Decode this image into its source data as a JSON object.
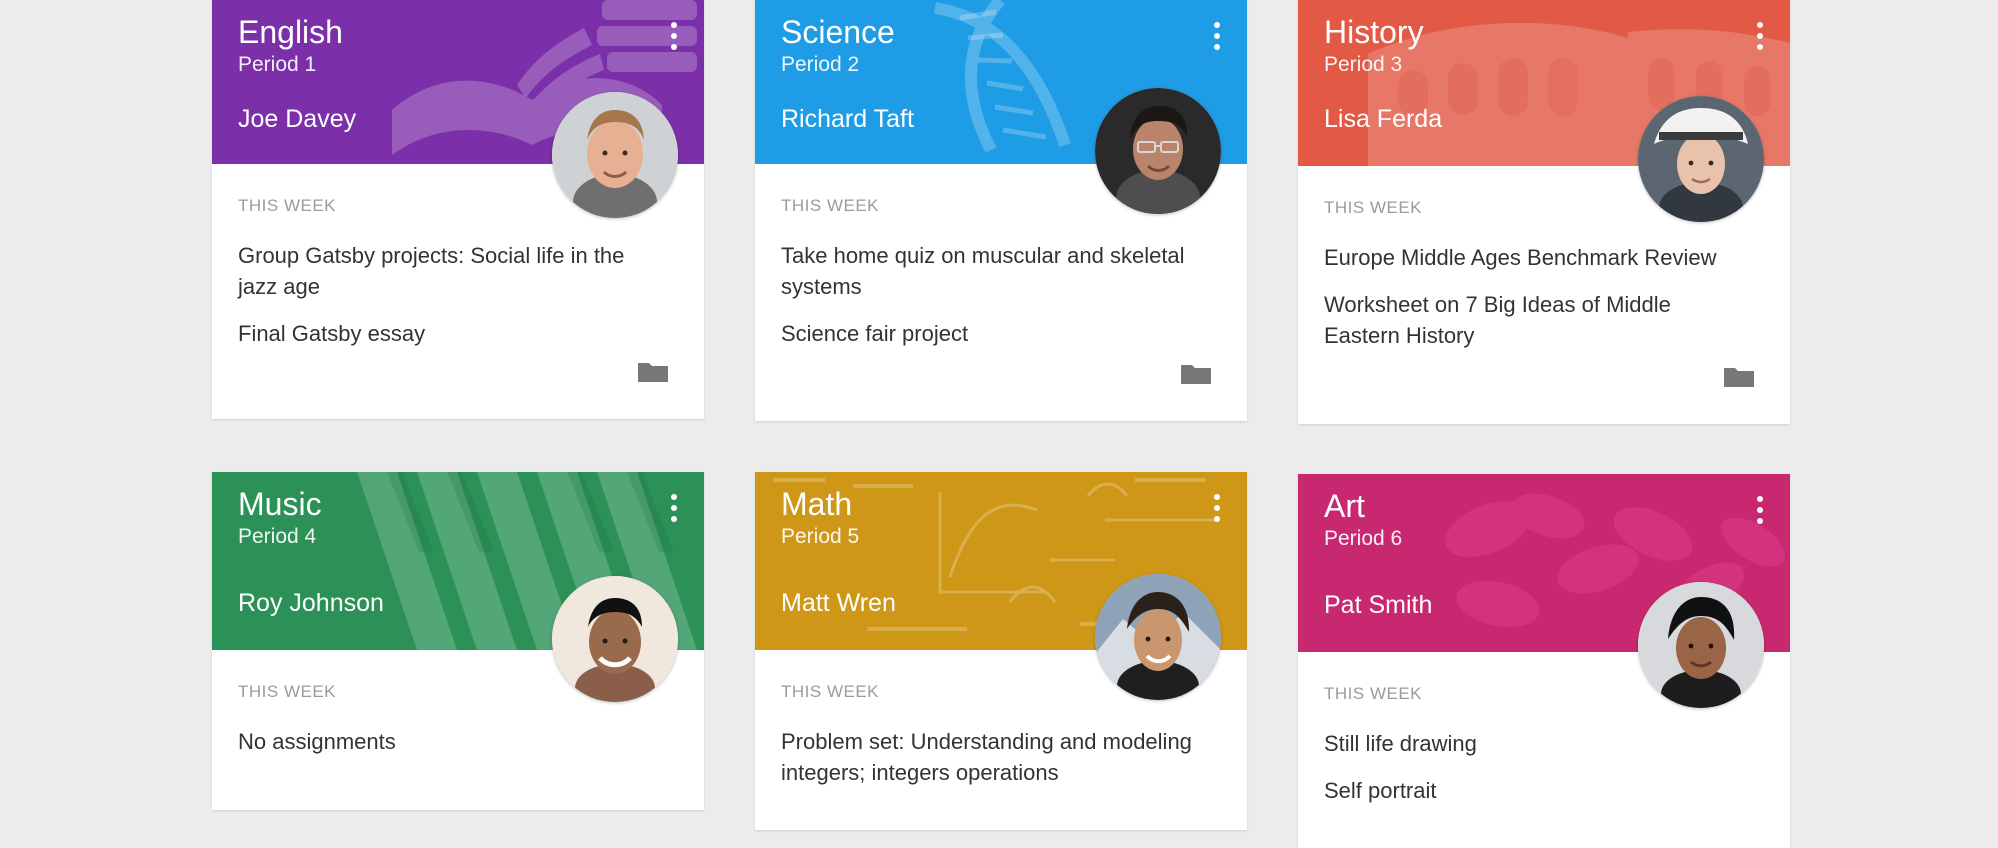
{
  "classes": [
    {
      "subject": "English",
      "period": "Period 1",
      "teacher": "Joe Davey",
      "color": "#7b2fa8",
      "section_label": "THIS WEEK",
      "assignments": [
        "Group Gatsby projects: Social life in the jazz age",
        "Final Gatsby essay"
      ],
      "has_folder": true,
      "header_art": "book-icon",
      "avatar_hair": "#a5774b",
      "avatar_skin": "#e7b093",
      "avatar_bg": "#cfd2d4"
    },
    {
      "subject": "Science",
      "period": "Period 2",
      "teacher": "Richard Taft",
      "color": "#1e9ce5",
      "section_label": "THIS WEEK",
      "assignments": [
        "Take home quiz on muscular and skeletal systems",
        "Science fair project"
      ],
      "has_folder": true,
      "header_art": "dna-icon",
      "avatar_hair": "#1c1714",
      "avatar_skin": "#b98469",
      "avatar_bg": "#2a2a2a"
    },
    {
      "subject": "History",
      "period": "Period 3",
      "teacher": "Lisa Ferda",
      "color": "#e25a45",
      "section_label": "THIS WEEK",
      "assignments": [
        "Europe Middle Ages Benchmark Review",
        "Worksheet on 7 Big Ideas of Middle Eastern History"
      ],
      "has_folder": true,
      "header_art": "colosseum-icon",
      "avatar_hair": "#f2f2f2",
      "avatar_skin": "#e8c2aa",
      "avatar_bg": "#5b6670"
    },
    {
      "subject": "Music",
      "period": "Period 4",
      "teacher": "Roy Johnson",
      "color": "#2b9157",
      "section_label": "THIS WEEK",
      "assignments": [
        "No assignments"
      ],
      "has_folder": false,
      "header_art": "piano-keys-icon",
      "avatar_hair": "#111111",
      "avatar_skin": "#9a6a4c",
      "avatar_bg": "#f0e8dd"
    },
    {
      "subject": "Math",
      "period": "Period 5",
      "teacher": "Matt Wren",
      "color": "#cf9718",
      "section_label": "THIS WEEK",
      "assignments": [
        "Problem set: Understanding and modeling integers; integers operations"
      ],
      "has_folder": false,
      "header_art": "math-formulas-icon",
      "avatar_hair": "#2b211b",
      "avatar_skin": "#c9966d",
      "avatar_bg": "#8ea3b7"
    },
    {
      "subject": "Art",
      "period": "Period 6",
      "teacher": "Pat Smith",
      "color": "#c8286f",
      "section_label": "THIS WEEK",
      "assignments": [
        "Still life drawing",
        "Self portrait"
      ],
      "has_folder": false,
      "header_art": "flowers-icon",
      "avatar_hair": "#111111",
      "avatar_skin": "#9a6547",
      "avatar_bg": "#d7d9dc"
    }
  ]
}
